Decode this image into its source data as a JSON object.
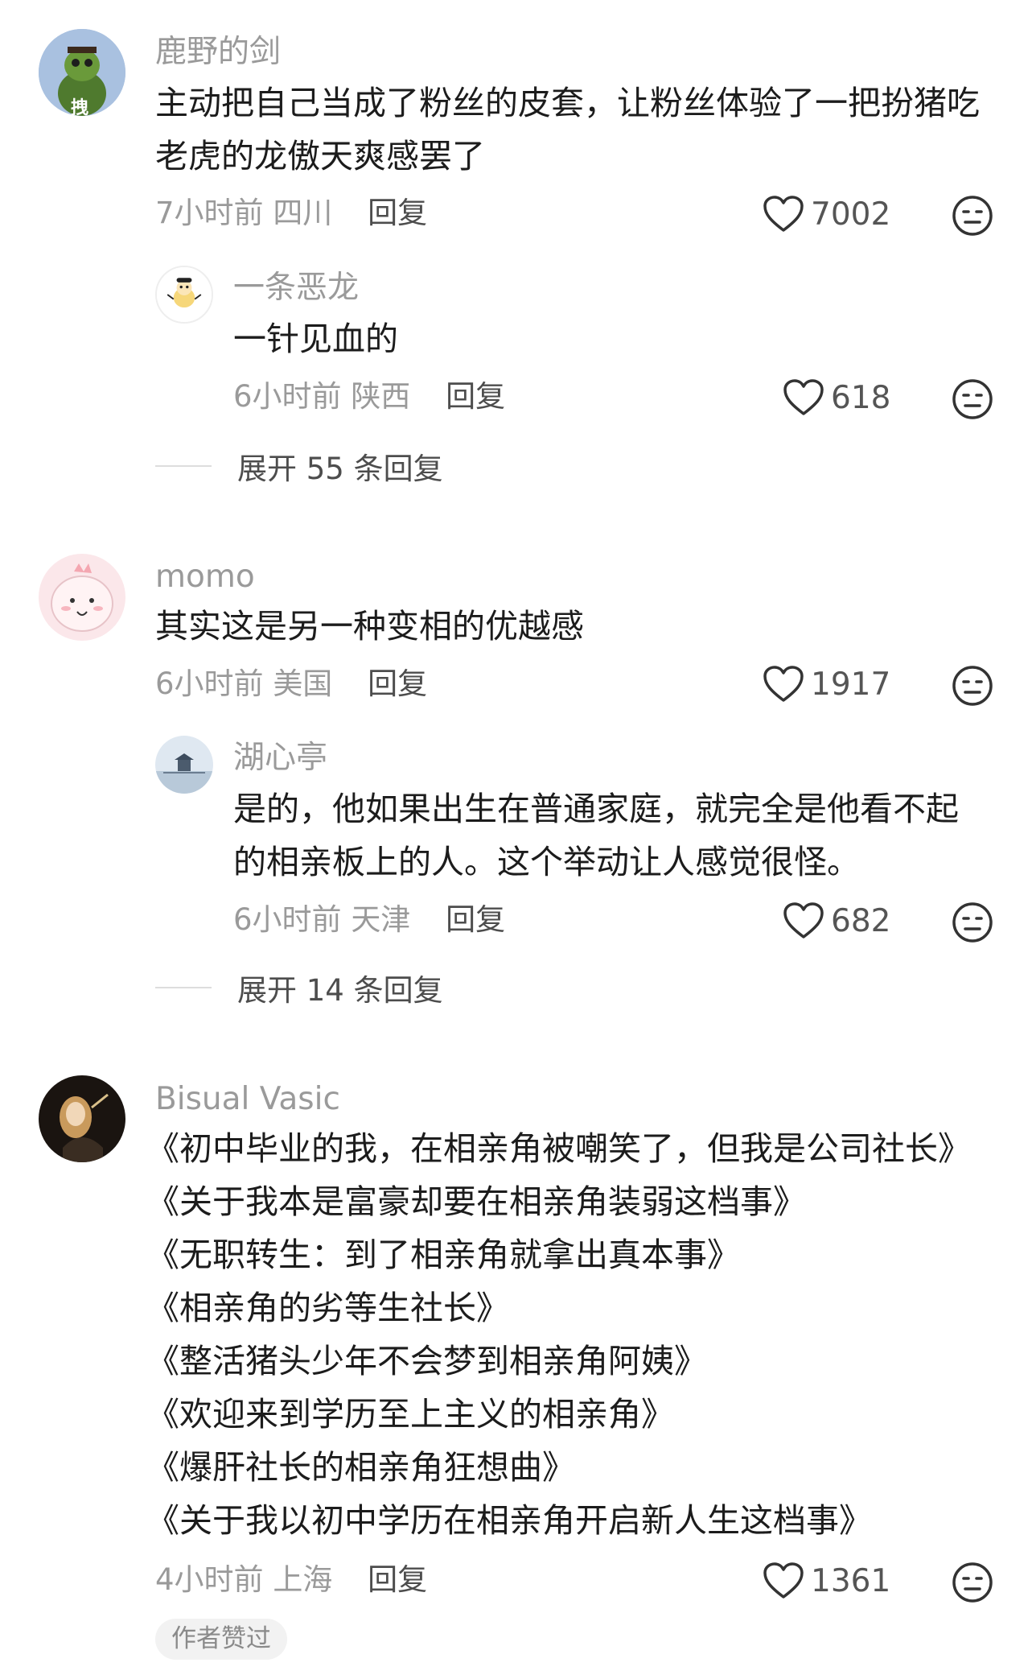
{
  "comments": [
    {
      "username": "鹿野的剑",
      "avatar_badge": "拽",
      "lines": [
        "主动把自己当成了粉丝的皮套，让粉丝体验了一把扮猪吃",
        "老虎的龙傲天爽感罢了"
      ],
      "time": "7小时前",
      "location": "四川",
      "reply_label": "回复",
      "likes": "7002",
      "reply": {
        "username": "一条恶龙",
        "lines": [
          "一针见血的"
        ],
        "time": "6小时前",
        "location": "陕西",
        "reply_label": "回复",
        "likes": "618"
      },
      "expand": "展开 55 条回复"
    },
    {
      "username": "momo",
      "lines": [
        "其实这是另一种变相的优越感"
      ],
      "time": "6小时前",
      "location": "美国",
      "reply_label": "回复",
      "likes": "1917",
      "reply": {
        "username": "湖心亭",
        "lines": [
          "是的，他如果出生在普通家庭，就完全是他看不起",
          "的相亲板上的人。这个举动让人感觉很怪。"
        ],
        "time": "6小时前",
        "location": "天津",
        "reply_label": "回复",
        "likes": "682"
      },
      "expand": "展开 14 条回复"
    },
    {
      "username": "Bisual Vasic",
      "lines": [
        "《初中毕业的我，在相亲角被嘲笑了，但我是公司社长》",
        "《关于我本是富豪却要在相亲角装弱这档事》",
        "《无职转生：到了相亲角就拿出真本事》",
        "《相亲角的劣等生社长》",
        "《整活猪头少年不会梦到相亲角阿姨》",
        "《欢迎来到学历至上主义的相亲角》",
        "《爆肝社长的相亲角狂想曲》",
        "《关于我以初中学历在相亲角开启新人生这档事》"
      ],
      "time": "4小时前",
      "location": "上海",
      "reply_label": "回复",
      "likes": "1361",
      "badge": "作者赞过"
    }
  ],
  "icons": {
    "like": "heart-icon",
    "dislike": "dislike-face-icon"
  },
  "colors": {
    "meta_gray": "#9a9a9a",
    "text": "#1c1c1c",
    "badge_bg": "#f2f2f2"
  }
}
